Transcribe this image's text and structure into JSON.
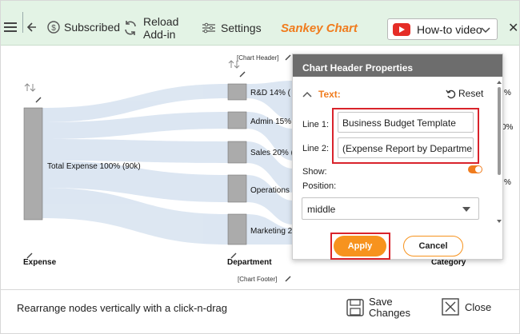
{
  "toolbar": {
    "subscribed": "Subscribed",
    "reload_line1": "Reload",
    "reload_line2": "Add-in",
    "settings": "Settings",
    "brand": "Sankey Chart",
    "howto": "How-to video"
  },
  "chart": {
    "chart_header_tag": "[Chart Header]",
    "chart_footer_tag": "[Chart Footer]",
    "source_node": "Total Expense 100% (90k)",
    "dept_nodes": [
      "R&D 14% (",
      "Admin 15%",
      "Sales 20% (",
      "Operations",
      "Marketing 2"
    ],
    "axis_labels": {
      "expense": "Expense",
      "department": "Department",
      "category": "Category"
    },
    "clipped_right": [
      "%",
      "0%",
      "%"
    ]
  },
  "panel": {
    "title": "Chart Header Properties",
    "section": "Text:",
    "reset": "Reset",
    "line1_label": "Line 1:",
    "line1_value": "Business Budget Template",
    "line2_label": "Line 2:",
    "line2_value": "(Expense Report by Departme",
    "show_label": "Show:",
    "show_on": true,
    "position_label": "Position:",
    "position_value": "middle",
    "apply": "Apply",
    "cancel": "Cancel"
  },
  "footer": {
    "hint": "Rearrange nodes vertically with a click-n-drag",
    "save_line1": "Save",
    "save_line2": "Changes",
    "close": "Close"
  },
  "colors": {
    "toolbar_bg": "#e3f3e5",
    "brand": "#f07c1e",
    "accent_orange": "#f7931e",
    "highlight_red": "#d9232b",
    "node_gray": "#ababab",
    "flow_blue": "#d9e4f1",
    "panel_header": "#6d6d6d"
  }
}
